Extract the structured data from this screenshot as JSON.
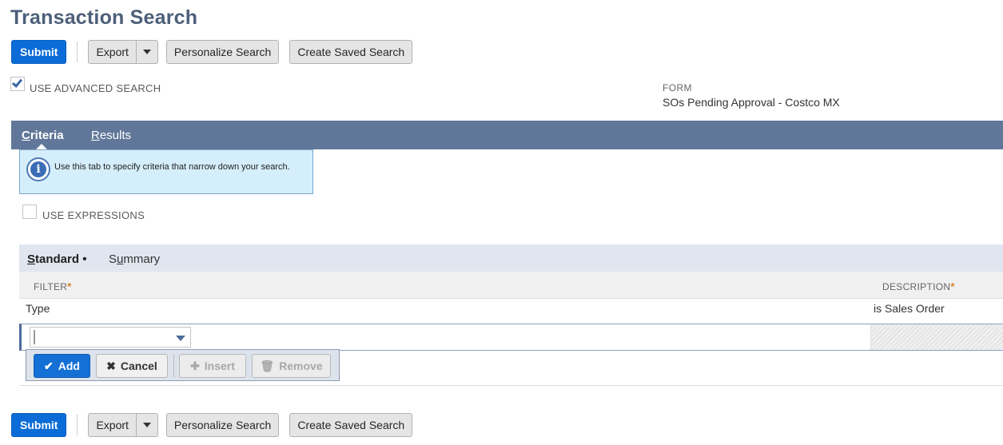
{
  "page": {
    "title": "Transaction Search"
  },
  "toolbar": {
    "submit": "Submit",
    "export": "Export",
    "personalize": "Personalize Search",
    "create_saved": "Create Saved Search"
  },
  "options": {
    "use_advanced_search": {
      "label": "USE ADVANCED SEARCH",
      "checked": true
    },
    "use_expressions": {
      "label": "USE EXPRESSIONS",
      "checked": false
    }
  },
  "form": {
    "label": "FORM",
    "value": "SOs Pending Approval - Costco MX"
  },
  "tabs": [
    {
      "label": "Criteria",
      "accel": "C",
      "rest": "riteria",
      "active": true
    },
    {
      "label": "Results",
      "accel": "R",
      "rest": "esults",
      "active": false
    }
  ],
  "info": {
    "text": "Use this tab to specify criteria that narrow down your search."
  },
  "subtabs": [
    {
      "label": "Standard",
      "accel": "S",
      "rest": "tandard",
      "marker": "•",
      "active": true
    },
    {
      "label": "Summary",
      "pre": "S",
      "accel": "u",
      "rest": "mmary",
      "active": false
    }
  ],
  "grid": {
    "columns": [
      {
        "label": "FILTER",
        "required": "*"
      },
      {
        "label": "DESCRIPTION",
        "required": "*"
      }
    ],
    "rows": [
      {
        "filter": "Type",
        "description": "is Sales Order"
      }
    ],
    "edit_row": {
      "filter_value": "",
      "description_value": ""
    }
  },
  "actions": {
    "add": "Add",
    "cancel": "Cancel",
    "insert": "Insert",
    "remove": "Remove"
  },
  "colors": {
    "title": "#4d5f79",
    "tabbar": "#607799",
    "primary": "#0b6cd8",
    "info_bg": "#d5eefb",
    "required_star": "#d4802b"
  }
}
